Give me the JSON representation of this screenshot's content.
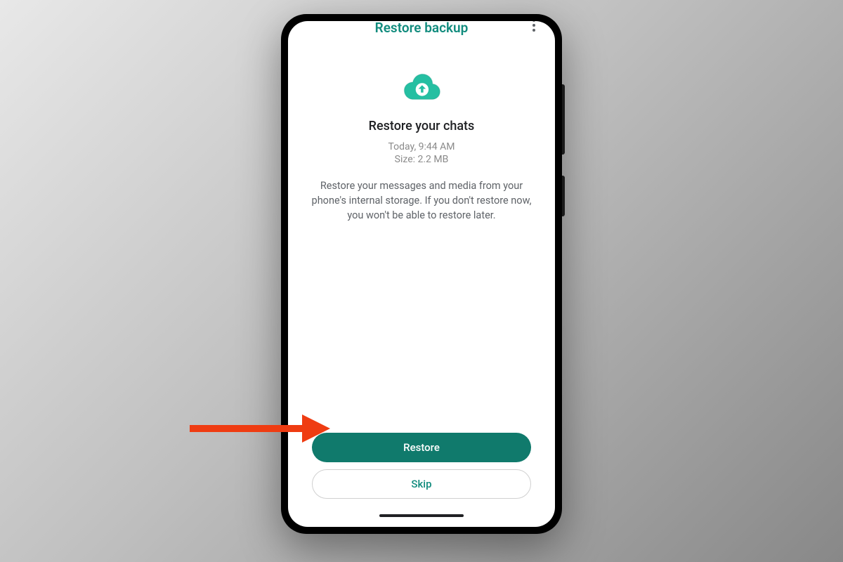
{
  "header": {
    "title": "Restore backup"
  },
  "content": {
    "heading": "Restore your chats",
    "backup_time": "Today, 9:44 AM",
    "backup_size": "Size: 2.2 MB",
    "description": "Restore your messages and media from your phone's internal storage. If you don't restore now, you won't be able to restore later."
  },
  "buttons": {
    "primary": "Restore",
    "secondary": "Skip"
  },
  "colors": {
    "accent": "#128C7E",
    "primary_btn": "#107a6c"
  }
}
